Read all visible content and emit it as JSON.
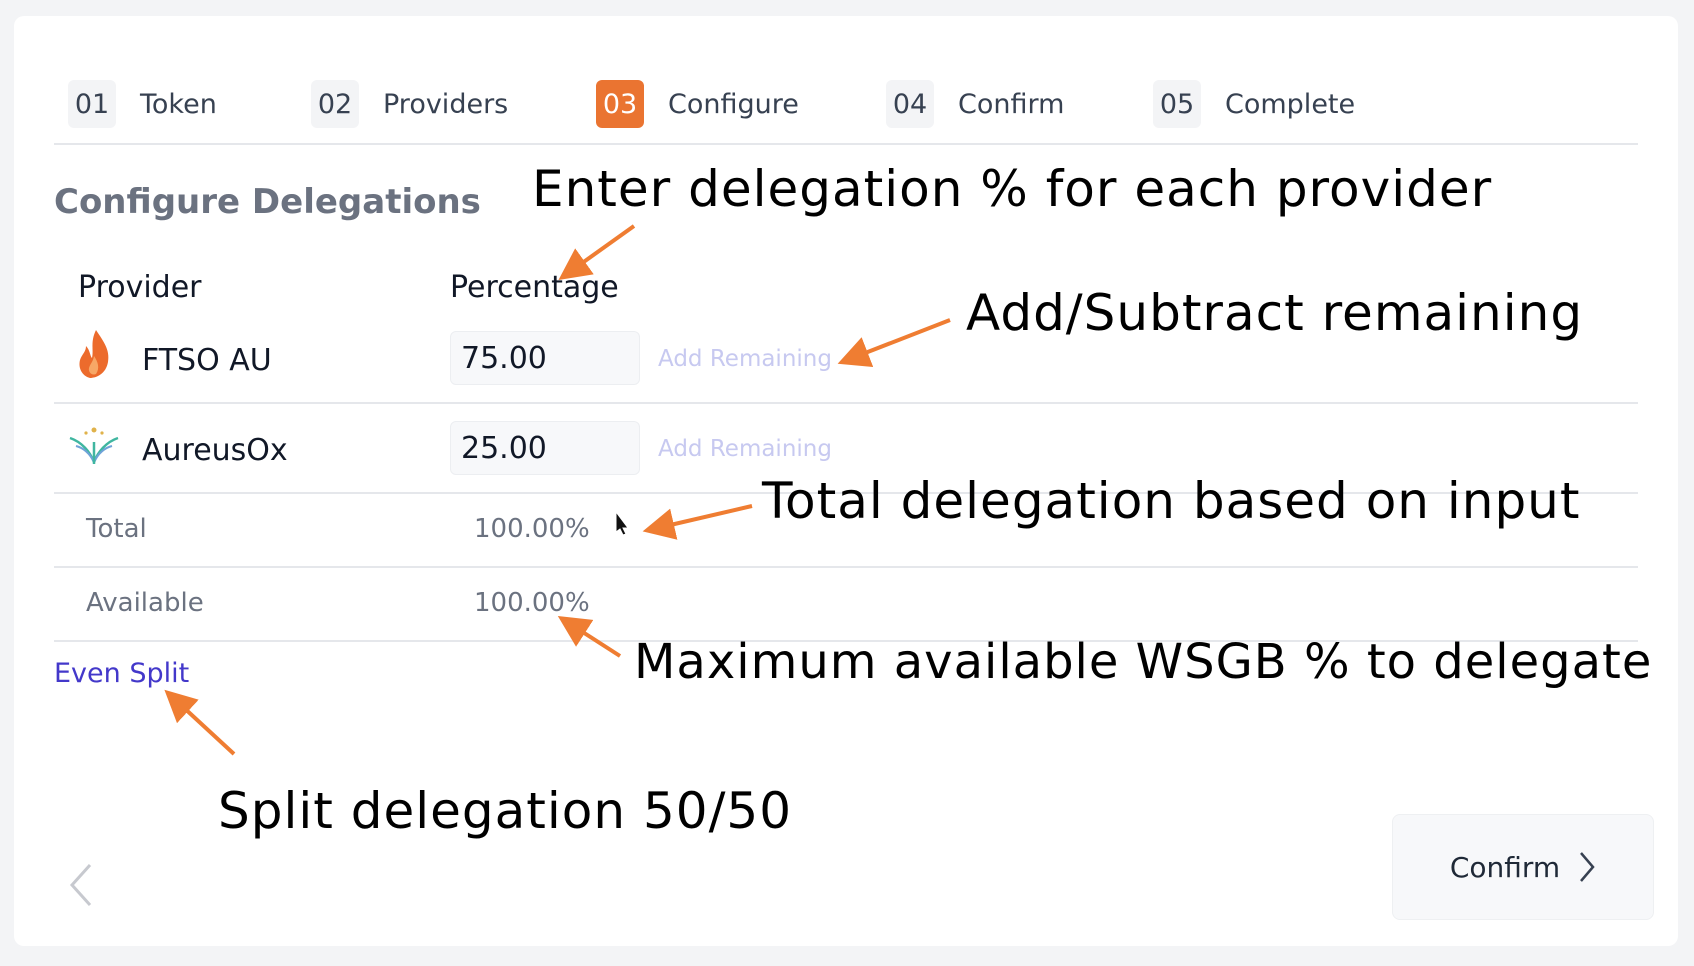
{
  "steps": [
    {
      "num": "01",
      "label": "Token"
    },
    {
      "num": "02",
      "label": "Providers"
    },
    {
      "num": "03",
      "label": "Configure"
    },
    {
      "num": "04",
      "label": "Confirm"
    },
    {
      "num": "05",
      "label": "Complete"
    }
  ],
  "active_step": "03",
  "section_title": "Configure Delegations",
  "columns": {
    "provider": "Provider",
    "percentage": "Percentage"
  },
  "providers": [
    {
      "name": "FTSO AU",
      "icon": "flame-icon",
      "percentage": "75.00",
      "add_remaining": "Add Remaining"
    },
    {
      "name": "AureusOx",
      "icon": "aureusox-logo-icon",
      "percentage": "25.00",
      "add_remaining": "Add Remaining"
    }
  ],
  "total": {
    "label": "Total",
    "value": "100.00%"
  },
  "available": {
    "label": "Available",
    "value": "100.00%"
  },
  "even_split": "Even Split",
  "confirm_button": "Confirm",
  "annotations": {
    "enter_delegation": "Enter delegation % for each provider",
    "add_subtract": "Add/Subtract remaining",
    "total_delegation": "Total delegation based on input",
    "max_available": "Maximum available WSGB % to delegate",
    "split": "Split delegation 50/50"
  },
  "colors": {
    "accent": "#ea7431",
    "link": "#4338ca",
    "annotation_arrow": "#ef7d32"
  }
}
